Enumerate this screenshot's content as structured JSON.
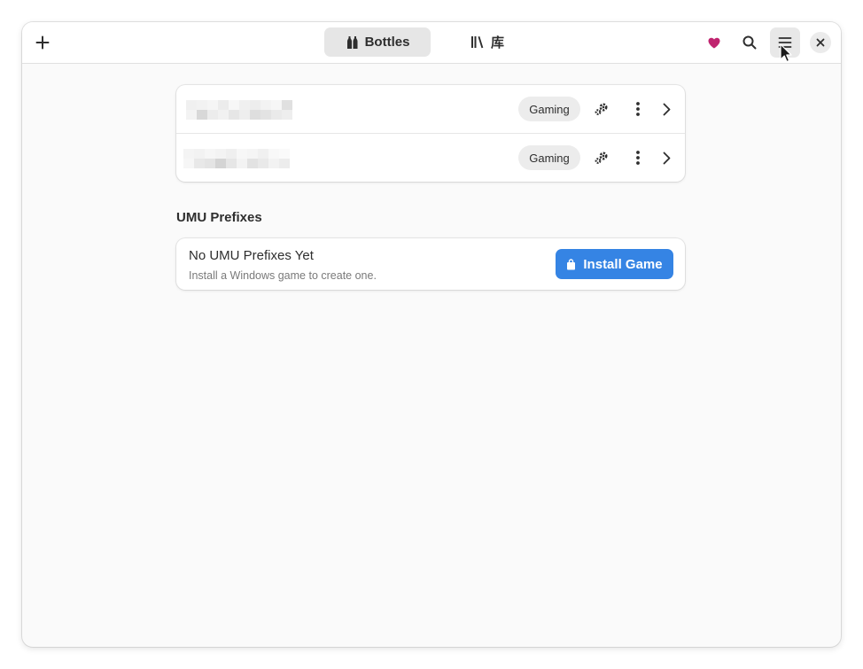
{
  "header": {
    "add_icon": "plus-icon",
    "tabs": [
      {
        "label": "Bottles",
        "icon": "bottles-icon",
        "selected": true
      },
      {
        "label": "库",
        "icon": "library-icon",
        "selected": false
      }
    ],
    "donate_icon": "heart-icon",
    "search_icon": "search-icon",
    "menu_icon": "hamburger-menu-icon",
    "close_icon": "close-icon"
  },
  "bottles": [
    {
      "name": "",
      "tag": "Gaming"
    },
    {
      "name": "",
      "tag": "Gaming"
    }
  ],
  "umu": {
    "section_title": "UMU Prefixes",
    "empty_title": "No UMU Prefixes Yet",
    "empty_subtitle": "Install a Windows game to create one.",
    "install_label": "Install Game",
    "install_icon": "shopping-bag-icon"
  },
  "colors": {
    "accent": "#3584e4",
    "heart": "#c0246f",
    "window_bg": "#fafafa"
  }
}
